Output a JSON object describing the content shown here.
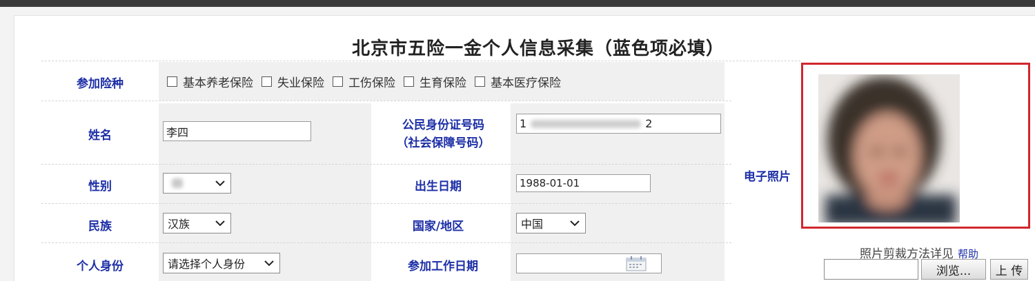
{
  "form": {
    "title": "北京市五险一金个人信息采集（蓝色项必填）",
    "insurance": {
      "label": "参加险种",
      "options": [
        "基本养老保险",
        "失业保险",
        "工伤保险",
        "生育保险",
        "基本医疗保险"
      ]
    },
    "name": {
      "label": "姓名",
      "value": "李四"
    },
    "id_number": {
      "label_line1": "公民身份证号码",
      "label_line2": "（社会保障号码）",
      "prefix": "1",
      "suffix": "2"
    },
    "gender": {
      "label": "性别"
    },
    "birth_date": {
      "label": "出生日期",
      "value": "1988-01-01"
    },
    "ethnicity": {
      "label": "民族",
      "value": "汉族"
    },
    "country": {
      "label": "国家/地区",
      "value": "中国"
    },
    "identity": {
      "label": "个人身份",
      "value": "请选择个人身份"
    },
    "work_start": {
      "label": "参加工作日期",
      "value": ""
    }
  },
  "photo": {
    "label": "电子照片",
    "crop_hint": "照片剪裁方法详见",
    "help_link": "帮助",
    "browse_button": "浏览...",
    "upload_button": "上 传"
  },
  "colors": {
    "required_label": "#1d2fa6",
    "photo_border": "#d1262c"
  }
}
